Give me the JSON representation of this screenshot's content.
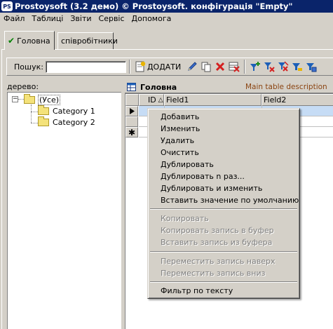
{
  "window": {
    "title": "Prostoysoft (3.2 демо) © Prostoysoft. конфігурація \"Empty\"",
    "icon_text": "PS"
  },
  "menubar": {
    "items": [
      "Файл",
      "Таблиці",
      "Звіти",
      "Сервіс",
      "Допомога"
    ]
  },
  "tabs": [
    {
      "label": "Головна",
      "active": true,
      "icon": "check-icon"
    },
    {
      "label": "співробітники",
      "active": false
    }
  ],
  "toolbar": {
    "search_label": "Пошук:",
    "search_value": "",
    "add_label": "ДОДАТИ",
    "icons": [
      "add-record-icon",
      "edit-pencil-icon",
      "copy-icon",
      "delete-icon",
      "delete-all-icon",
      "filter-add-icon",
      "filter-remove-icon",
      "filter-clear-icon",
      "filter-icon",
      "filter-save-icon"
    ]
  },
  "tree": {
    "label": "дерево:",
    "root": "(Усе)",
    "children": [
      "Category 1",
      "Category 2"
    ]
  },
  "grid": {
    "title": "Головна",
    "description": "Main table description",
    "columns": [
      "ID",
      "Field1",
      "Field2"
    ],
    "sort_indicator": "△"
  },
  "context_menu": {
    "items": [
      {
        "label": "Добавить",
        "enabled": true
      },
      {
        "label": "Изменить",
        "enabled": true
      },
      {
        "label": "Удалить",
        "enabled": true
      },
      {
        "label": "Очистить",
        "enabled": true
      },
      {
        "label": "Дублировать",
        "enabled": true
      },
      {
        "label": "Дублировать n раз...",
        "enabled": true
      },
      {
        "label": "Дублировать и изменить",
        "enabled": true
      },
      {
        "label": "Вставить значение по умолчанию",
        "enabled": true
      },
      {
        "label": "Копировать",
        "enabled": false
      },
      {
        "label": "Копировать запись в буфер",
        "enabled": false
      },
      {
        "label": "Вставить запись из буфера",
        "enabled": false
      },
      {
        "label": "Переместить запись наверх",
        "enabled": false
      },
      {
        "label": "Переместить запись вниз",
        "enabled": false
      },
      {
        "label": "Фильтр по тексту",
        "enabled": true
      }
    ]
  },
  "colors": {
    "titlebar": "#0a246a",
    "face": "#d4d0c8",
    "selected_row": "#c6dcf5",
    "delete_red": "#d42020",
    "filter_blue": "#1c5fb8"
  }
}
